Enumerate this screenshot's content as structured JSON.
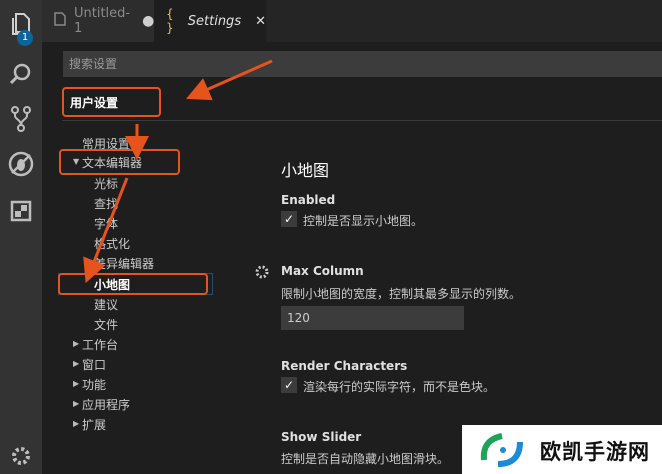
{
  "activity_bar": {
    "badge_count": "1",
    "icons": [
      "files-icon",
      "search-icon",
      "source-control-icon",
      "debug-icon",
      "extensions-icon",
      "settings-gear-icon"
    ]
  },
  "tabs": [
    {
      "label": "Untitled-1",
      "state": "modified-dot"
    },
    {
      "label": "Settings",
      "glyph": "{ }"
    }
  ],
  "search": {
    "placeholder": "搜索设置"
  },
  "scope": {
    "label": "用户设置"
  },
  "tree": [
    {
      "label": "常用设置"
    },
    {
      "label": "文本编辑器",
      "expanded": true
    },
    {
      "label": "光标"
    },
    {
      "label": "查找"
    },
    {
      "label": "字体"
    },
    {
      "label": "格式化"
    },
    {
      "label": "差异编辑器"
    },
    {
      "label": "小地图",
      "selected": true
    },
    {
      "label": "建议"
    },
    {
      "label": "文件"
    },
    {
      "label": "工作台"
    },
    {
      "label": "窗口"
    },
    {
      "label": "功能"
    },
    {
      "label": "应用程序"
    },
    {
      "label": "扩展"
    }
  ],
  "section": {
    "title": "小地图",
    "settings": [
      {
        "title": "Enabled",
        "desc": "控制是否显示小地图。",
        "checked": true
      },
      {
        "title": "Max Column",
        "desc": "限制小地图的宽度，控制其最多显示的列数。",
        "value": "120"
      },
      {
        "title": "Render Characters",
        "desc": "渲染每行的实际字符，而不是色块。",
        "checked": true
      },
      {
        "title": "Show Slider",
        "desc": "控制是否自动隐藏小地图滑块。"
      }
    ]
  },
  "watermark": {
    "text": "欧凯手游网"
  },
  "colors": {
    "accent": "#0e639c",
    "annotation": "#e6531d",
    "background": "#1e1e1e",
    "sidebar": "#333333"
  }
}
